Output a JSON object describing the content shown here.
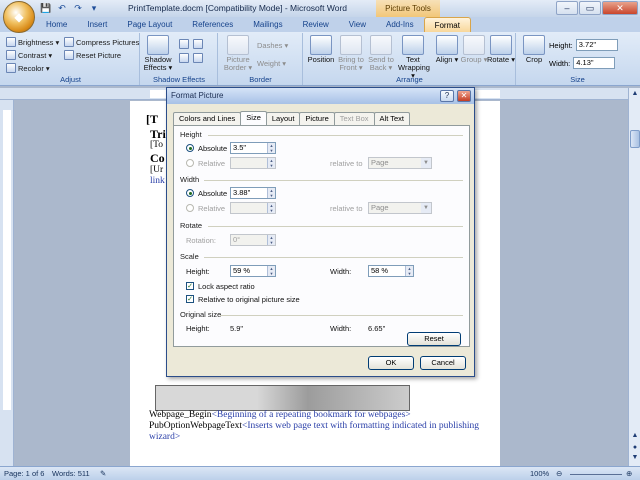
{
  "window": {
    "title": "PrintTemplate.docm [Compatibility Mode] - Microsoft Word",
    "contextual_tab": "Picture Tools",
    "controls": {
      "minimize": "–",
      "maximize": "▭",
      "close": "✕"
    }
  },
  "qat": {
    "save": "💾",
    "undo": "↶",
    "redo": "↷",
    "more": "▾"
  },
  "ribbon": {
    "tabs": [
      "Home",
      "Insert",
      "Page Layout",
      "References",
      "Mailings",
      "Review",
      "View",
      "Add-Ins",
      "Format"
    ],
    "active_tab": "Format",
    "adjust": {
      "label": "Adjust",
      "brightness": "Brightness ▾",
      "contrast": "Contrast ▾",
      "recolor": "Recolor ▾",
      "compress": "Compress Pictures",
      "reset": "Reset Picture"
    },
    "shadow": {
      "label": "Shadow Effects",
      "button": "Shadow Effects ▾"
    },
    "border": {
      "label": "Border",
      "picture_border": "Picture Border ▾",
      "dashes": "Dashes ▾",
      "weight": "Weight ▾"
    },
    "arrange": {
      "label": "Arrange",
      "position": "Position",
      "bring_to_front": "Bring to Front ▾",
      "send_to_back": "Send to Back ▾",
      "text_wrapping": "Text Wrapping ▾",
      "align": "Align ▾",
      "group": "Group ▾",
      "rotate": "Rotate ▾"
    },
    "size": {
      "label": "Size",
      "crop": "Crop",
      "height_label": "Height:",
      "height_value": "3.72\"",
      "width_label": "Width:",
      "width_value": "4.13\""
    }
  },
  "document": {
    "line1": "[T",
    "line2": "Tri",
    "line3": "[To",
    "line4": "Co",
    "line5": "[Ur",
    "line6": "link",
    "webpage_begin": "Webpage_Begin",
    "webpage_begin_note": "<Beginning of a repeating bookmark for webpages>",
    "pub_option": "PubOptionWebpageText",
    "pub_option_note": "<Inserts web page text with formatting indicated in publishing",
    "wizard": "wizard>"
  },
  "status": {
    "page": "Page: 1 of 6",
    "words": "Words: 511",
    "zoom": "100%"
  },
  "dialog": {
    "title": "Format Picture",
    "help": "?",
    "close": "✕",
    "tabs": [
      "Colors and Lines",
      "Size",
      "Layout",
      "Picture",
      "Text Box",
      "Alt Text"
    ],
    "active_tab": "Size",
    "height": {
      "section": "Height",
      "absolute_label": "Absolute",
      "absolute_value": "3.5\"",
      "relative_label": "Relative",
      "relative_to_label": "relative to",
      "relative_to_value": "Page"
    },
    "width": {
      "section": "Width",
      "absolute_label": "Absolute",
      "absolute_value": "3.88\"",
      "relative_label": "Relative",
      "relative_to_label": "relative to",
      "relative_to_value": "Page"
    },
    "rotate": {
      "section": "Rotate",
      "rotation_label": "Rotation:",
      "rotation_value": "0°"
    },
    "scale": {
      "section": "Scale",
      "height_label": "Height:",
      "height_value": "59 %",
      "width_label": "Width:",
      "width_value": "58 %",
      "lock_aspect": "Lock aspect ratio",
      "relative_original": "Relative to original picture size"
    },
    "original": {
      "section": "Original size",
      "height_label": "Height:",
      "height_value": "5.9\"",
      "width_label": "Width:",
      "width_value": "6.65\"",
      "reset": "Reset"
    },
    "ok": "OK",
    "cancel": "Cancel"
  }
}
